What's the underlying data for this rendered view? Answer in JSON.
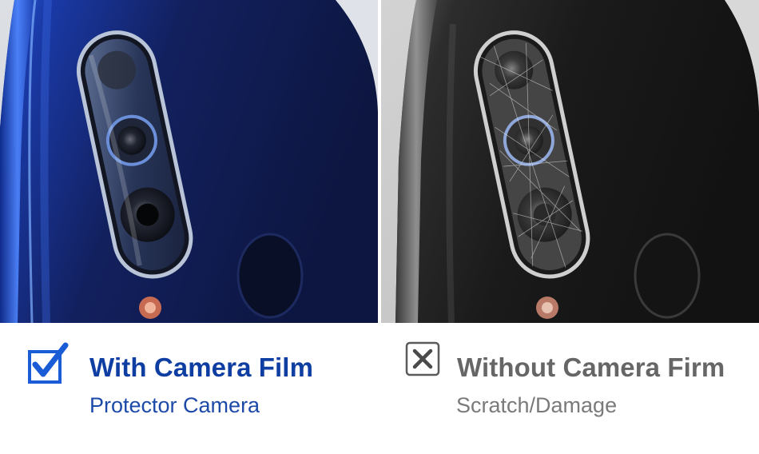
{
  "comparison": {
    "with_film": {
      "icon": "checked-box-icon",
      "title": "With Camera Film",
      "subtitle": "Protector Camera",
      "color": "#0f3ea3"
    },
    "without_film": {
      "icon": "x-box-icon",
      "title": "Without Camera Firm",
      "subtitle": "Scratch/Damage",
      "color": "#666666"
    }
  }
}
